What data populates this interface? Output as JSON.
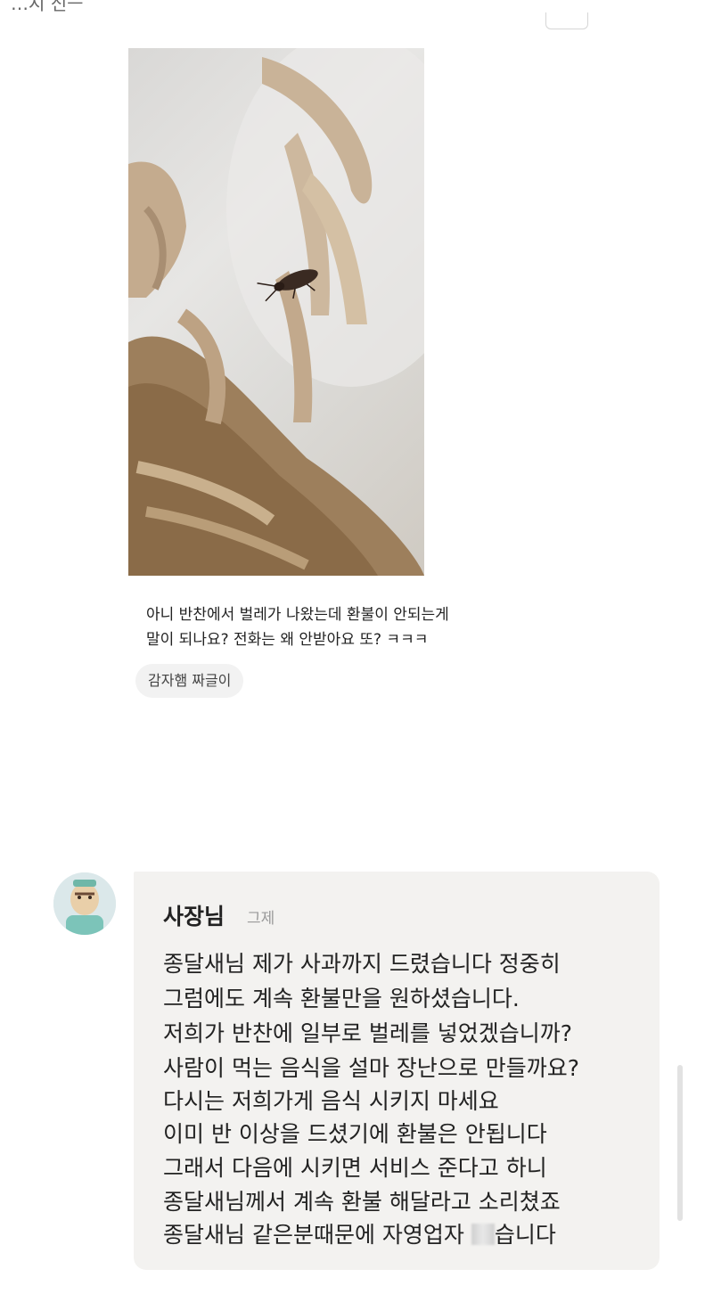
{
  "top_fragment": "…시 신ㅡ",
  "review": {
    "text": "아니 반찬에서 벌레가 나왔는데 환불이 안되는게\n말이 되나요? 전화는 왜 안받아요 또? ㅋㅋㅋ",
    "menu_chip": "감자햄 짜글이"
  },
  "reply": {
    "author": "사장님",
    "time": "그제",
    "lines": [
      "종달새님 제가 사과까지 드렸습니다 정중히",
      "그럼에도 계속 환불만을 원하셨습니다.",
      "저희가 반찬에 일부로 벌레를 넣었겠습니까?",
      "사람이 먹는 음식을 설마 장난으로 만들까요?",
      "다시는 저희가게 음식 시키지 마세요",
      "이미 반 이상을 드셨기에 환불은 안됩니다",
      "그래서 다음에 시키면 서비스 준다고 하니",
      "종달새님께서 계속 환불 해달라고 소리쳤죠"
    ],
    "last_line_before": "종달새님 같은분때문에 자영업자 ",
    "last_line_after": "습니다"
  },
  "icons": {
    "avatar": "owner-avatar-icon"
  }
}
